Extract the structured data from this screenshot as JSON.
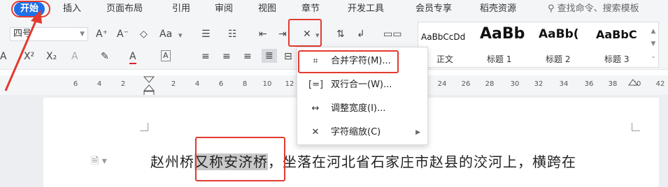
{
  "menubar": {
    "tabs": [
      "开始",
      "插入",
      "页面布局",
      "引用",
      "审阅",
      "视图",
      "章节",
      "开发工具",
      "会员专享",
      "稻壳资源"
    ],
    "active_tab": "开始",
    "search_placeholder": "查找命令、搜索模板"
  },
  "ribbon": {
    "font_name": "四号",
    "font_grow": "A⁺",
    "font_shrink": "A⁻",
    "clear_format": "◇",
    "change_case": "Aa",
    "bullet_list": "☰",
    "number_list": "☷",
    "decrease_indent": "⇤",
    "increase_indent": "⇥",
    "char_scale": "✕",
    "sort": "⇅",
    "para_mark": "↲",
    "show_hide": "▭▭",
    "superscript": "X²",
    "subscript": "X₂",
    "text_effect": "A",
    "highlight": "✎",
    "font_color": "A",
    "char_border": "A",
    "align_left": "≡",
    "align_center": "≡",
    "align_right": "≡",
    "justify": "≣",
    "distributed": "⊟",
    "styles": [
      {
        "sample": "AaBbCcDd",
        "label": "正文"
      },
      {
        "sample": "AaBb",
        "label": "标题 1"
      },
      {
        "sample": "AaBb(",
        "label": "标题 2"
      },
      {
        "sample": "AaBbC",
        "label": "标题 3"
      }
    ]
  },
  "ruler": {
    "ticks": [
      "6",
      "4",
      "2",
      "2",
      "4",
      "6",
      "8",
      "10",
      "12",
      "24",
      "26",
      "28",
      "30",
      "32",
      "34",
      "36",
      "38",
      "40",
      "42"
    ]
  },
  "dropdown": {
    "items": [
      {
        "icon": "合并字符",
        "label": "合并字符(M)..."
      },
      {
        "icon": "双行合一",
        "label": "双行合一(W)..."
      },
      {
        "icon": "调整宽度",
        "label": "调整宽度(I)..."
      },
      {
        "icon": "字符缩放",
        "label": "字符缩放(C)"
      }
    ]
  },
  "document": {
    "text_before": "赵州桥",
    "text_selected": "又称安济桥",
    "text_after": "，坐落在河北省石家庄市赵县的洨河上，横跨在"
  },
  "colors": {
    "accent": "#1f6fe8",
    "annotation_red": "#e23a2f",
    "selection_gray": "#c9c9c9"
  }
}
